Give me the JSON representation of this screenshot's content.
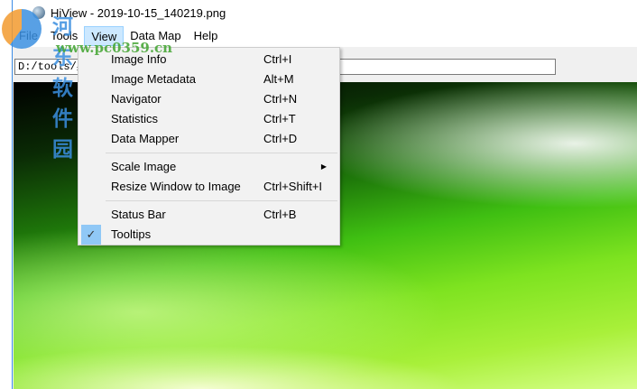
{
  "window": {
    "title": "HiView - 2019-10-15_140219.png"
  },
  "menubar": [
    "File",
    "Tools",
    "View",
    "Data Map",
    "Help"
  ],
  "path": "D:/tools/桌",
  "view_menu": {
    "group1": [
      {
        "label": "Image Info",
        "shortcut": "Ctrl+I"
      },
      {
        "label": "Image Metadata",
        "shortcut": "Alt+M"
      },
      {
        "label": "Navigator",
        "shortcut": "Ctrl+N"
      },
      {
        "label": "Statistics",
        "shortcut": "Ctrl+T"
      },
      {
        "label": "Data Mapper",
        "shortcut": "Ctrl+D"
      }
    ],
    "group2": [
      {
        "label": "Scale Image",
        "shortcut": ""
      },
      {
        "label": "Resize Window to Image",
        "shortcut": "Ctrl+Shift+I"
      }
    ],
    "group3": [
      {
        "label": "Status Bar",
        "shortcut": "Ctrl+B",
        "checked": false
      },
      {
        "label": "Tooltips",
        "shortcut": "",
        "checked": true
      }
    ]
  },
  "watermark": {
    "name": "河东软件园",
    "url": "www.pc0359.cn"
  }
}
